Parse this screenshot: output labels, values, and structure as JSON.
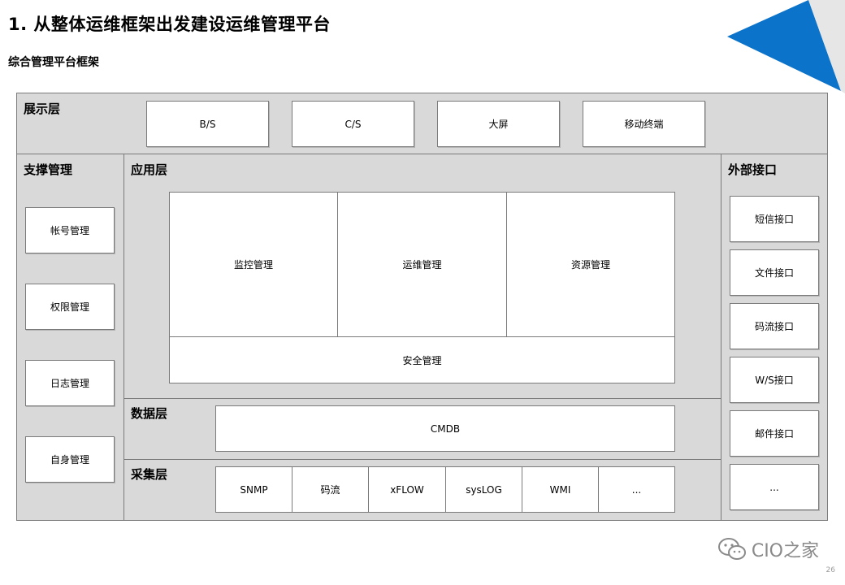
{
  "slide": {
    "title": "1. 从整体运维框架出发建设运维管理平台",
    "subtitle": "综合管理平台框架",
    "page_number": "26",
    "watermark": "CIO之家",
    "accent_color": "#0b73c9"
  },
  "presentation_layer": {
    "label": "展示层",
    "items": [
      "B/S",
      "C/S",
      "大屏",
      "移动终端"
    ]
  },
  "support_management": {
    "label": "支撑管理",
    "items": [
      "帐号管理",
      "权限管理",
      "日志管理",
      "自身管理"
    ]
  },
  "application_layer": {
    "label": "应用层",
    "modules": [
      "监控管理",
      "运维管理",
      "资源管理"
    ],
    "security": "安全管理"
  },
  "data_layer": {
    "label": "数据层",
    "item": "CMDB"
  },
  "collection_layer": {
    "label": "采集层",
    "items": [
      "SNMP",
      "码流",
      "xFLOW",
      "sysLOG",
      "WMI",
      "..."
    ]
  },
  "external_interface": {
    "label": "外部接口",
    "items": [
      "短信接口",
      "文件接口",
      "码流接口",
      "W/S接口",
      "邮件接口",
      "..."
    ]
  }
}
